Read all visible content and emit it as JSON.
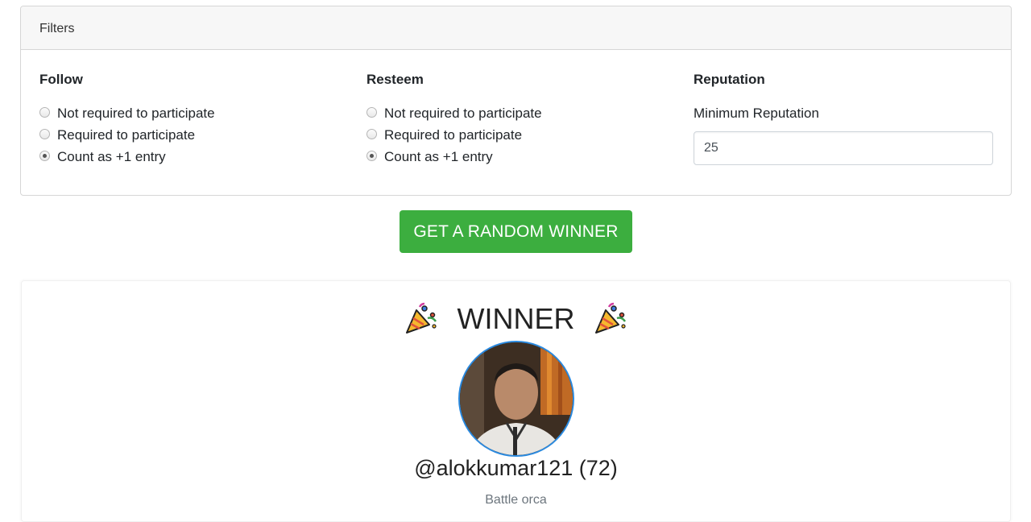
{
  "filters": {
    "header": "Filters",
    "follow": {
      "title": "Follow",
      "options": [
        "Not required to participate",
        "Required to participate",
        "Count as +1 entry"
      ],
      "selected": 2
    },
    "resteem": {
      "title": "Resteem",
      "options": [
        "Not required to participate",
        "Required to participate",
        "Count as +1 entry"
      ],
      "selected": 2
    },
    "reputation": {
      "title": "Reputation",
      "label": "Minimum Reputation",
      "value": "25"
    }
  },
  "action": {
    "button_label": "GET A RANDOM WINNER",
    "color": "#3cae3f"
  },
  "winner": {
    "title": "WINNER",
    "icon": "party-popper-icon",
    "username": "@alokkumar121 (72)",
    "tier": "Battle orca"
  }
}
